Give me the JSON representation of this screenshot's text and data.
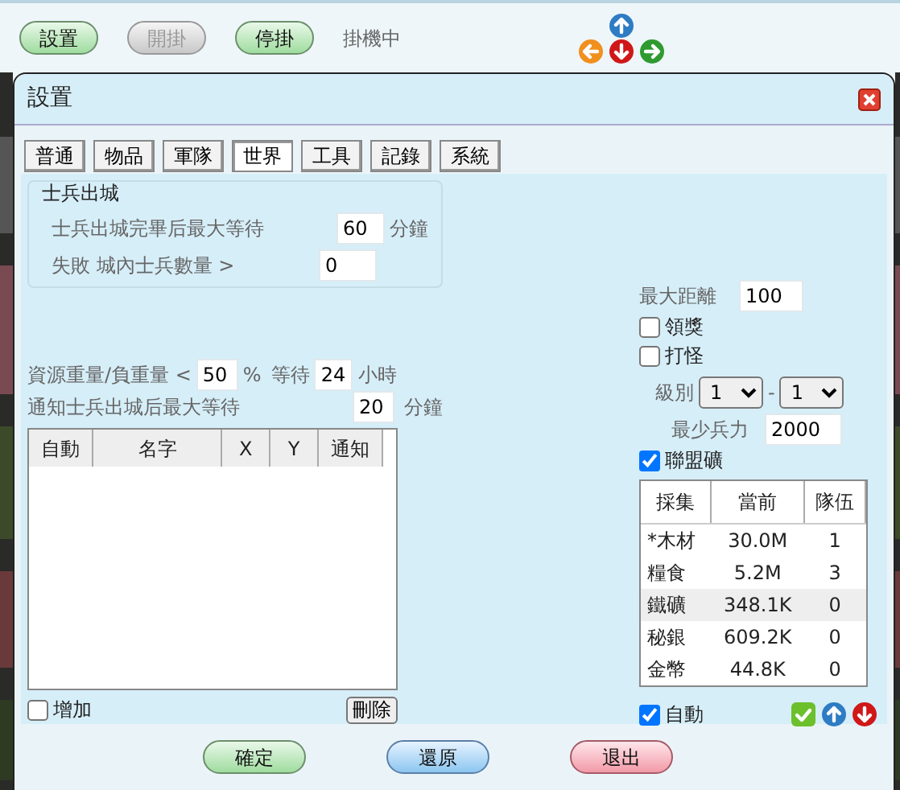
{
  "top_bar": {
    "buttons": [
      {
        "label": "設置",
        "kind": "green",
        "disabled": false
      },
      {
        "label": "開掛",
        "kind": "green",
        "disabled": true
      },
      {
        "label": "停掛",
        "kind": "green",
        "disabled": false
      }
    ],
    "status": "掛機中"
  },
  "dialog": {
    "title": "設置",
    "tabs": [
      {
        "label": "普通",
        "selected": false
      },
      {
        "label": "物品",
        "selected": false
      },
      {
        "label": "軍隊",
        "selected": false
      },
      {
        "label": "世界",
        "selected": true
      },
      {
        "label": "工具",
        "selected": false
      },
      {
        "label": "記錄",
        "selected": false
      },
      {
        "label": "系統",
        "selected": false
      }
    ]
  },
  "soldier_group": {
    "title": "士兵出城",
    "rows": [
      {
        "label": "士兵出城完畢后最大等待",
        "value": "60",
        "unit": "分鐘"
      },
      {
        "label": "失敗 城內士兵數量 >",
        "value": "0"
      }
    ]
  },
  "resource_row": {
    "label": "資源重量/負重量 <",
    "value": "50",
    "unit": "%",
    "wait_label": "等待",
    "wait_value": "24",
    "wait_unit": "小時"
  },
  "notify_row": {
    "label": "通知士兵出城后最大等待",
    "value": "20",
    "unit": "分鐘"
  },
  "city_table": {
    "columns": [
      "自動",
      "名字",
      "X",
      "Y",
      "通知"
    ]
  },
  "add_checkbox": {
    "label": "增加",
    "checked": false
  },
  "delete_button": "刪除",
  "max_distance": {
    "label": "最大距離",
    "value": "100"
  },
  "reward": {
    "label": "領獎",
    "checked": false
  },
  "monster": {
    "label": "打怪",
    "checked": false
  },
  "level": {
    "label": "級別",
    "from": "1",
    "separator": "-",
    "to": "1"
  },
  "min_troops": {
    "label": "最少兵力",
    "value": "2000"
  },
  "alliance_mine": {
    "label": "聯盟礦",
    "checked": true
  },
  "mine_table": {
    "columns": [
      "採集",
      "當前",
      "隊伍"
    ],
    "rows": [
      {
        "cells": [
          "*木材",
          "30.0M",
          "1"
        ],
        "selected": false
      },
      {
        "cells": [
          "糧食",
          "5.2M",
          "3"
        ],
        "selected": false
      },
      {
        "cells": [
          "鐵礦",
          "348.1K",
          "0"
        ],
        "selected": true
      },
      {
        "cells": [
          "秘銀",
          "609.2K",
          "0"
        ],
        "selected": false
      },
      {
        "cells": [
          "金幣",
          "44.8K",
          "0"
        ],
        "selected": false
      }
    ]
  },
  "auto": {
    "label": "自動",
    "checked": true
  },
  "footer_buttons": [
    {
      "label": "確定",
      "kind": "green"
    },
    {
      "label": "還原",
      "kind": "blue"
    },
    {
      "label": "退出",
      "kind": "red"
    }
  ]
}
